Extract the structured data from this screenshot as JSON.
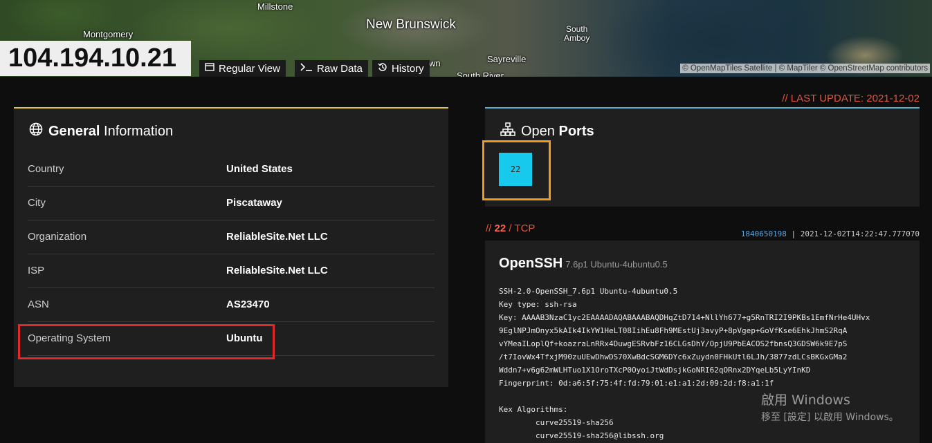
{
  "map": {
    "places": {
      "millstone": "Millstone",
      "montgomery": "Montgomery",
      "new_brunswick": "New Brunswick",
      "south_amboy_1": "South",
      "south_amboy_2": "Amboy",
      "sayreville": "Sayreville",
      "south_river": "South River",
      "town_fragment": "wn"
    },
    "attribution": "© OpenMapTiles Satellite | © MapTiler © OpenStreetMap contributors"
  },
  "header": {
    "ip": "104.194.10.21",
    "buttons": [
      {
        "label": "Regular View",
        "icon": "browser-window-icon"
      },
      {
        "label": "Raw Data",
        "icon": "terminal-icon"
      },
      {
        "label": "History",
        "icon": "history-icon"
      }
    ]
  },
  "general": {
    "title_bold": "General",
    "title_light": " Information",
    "rows": [
      {
        "label": "Country",
        "value": "United States"
      },
      {
        "label": "City",
        "value": "Piscataway"
      },
      {
        "label": "Organization",
        "value": "ReliableSite.Net LLC"
      },
      {
        "label": "ISP",
        "value": "ReliableSite.Net LLC"
      },
      {
        "label": "ASN",
        "value": "AS23470"
      },
      {
        "label": "Operating System",
        "value": "Ubuntu"
      }
    ]
  },
  "last_update": "// LAST UPDATE: 2021-12-02",
  "ports": {
    "title_light": "Open ",
    "title_bold": "Ports",
    "list": [
      "22"
    ]
  },
  "service": {
    "prefix": "// ",
    "port": "22",
    "proto": " / TCP",
    "hash": "1840650198",
    "timestamp": " | 2021-12-02T14:22:47.777070",
    "name": "OpenSSH",
    "version": "7.6p1 Ubuntu-4ubuntu0.5",
    "banner": "SSH-2.0-OpenSSH_7.6p1 Ubuntu-4ubuntu0.5\nKey type: ssh-rsa\nKey: AAAAB3NzaC1yc2EAAAADAQABAAABAQDHqZtD714+NllYh677+g5RnTRI2I9PKBs1EmfNrHe4UHvx\n9EglNPJmOnyx5kAIk4IkYW1HeLT08IihEu8Fh9MEstUj3avyP+8pVgep+GoVfKse6EhkJhmS2RqA\nvYMeaILoplQf+koazraLnRRx4DuwgESRvbFz16CLGsDhY/OpjU9PbEACOS2fbnsQ3GDSW6k9E7pS\n/t7IovWx4TfxjM90zuUEwDhwDS70XwBdcSGM6DYc6xZuydn0FHkUtl6LJh/3877zdLCsBKGxGMa2\nWddn7+v6g62mWLHTuo1X1OroTXcP0OyoiJtWdDsjkGoNRI62qORnx2DYqeLb5LyYInKD\nFingerprint: 0d:a6:5f:75:4f:fd:79:01:e1:a1:2d:09:2d:f8:a1:1f\n\nKex Algorithms:\n\tcurve25519-sha256\n\tcurve25519-sha256@libssh.org"
  },
  "windows_watermark": {
    "line1": "啟用 Windows",
    "line2": "移至 [設定] 以啟用 Windows。"
  }
}
